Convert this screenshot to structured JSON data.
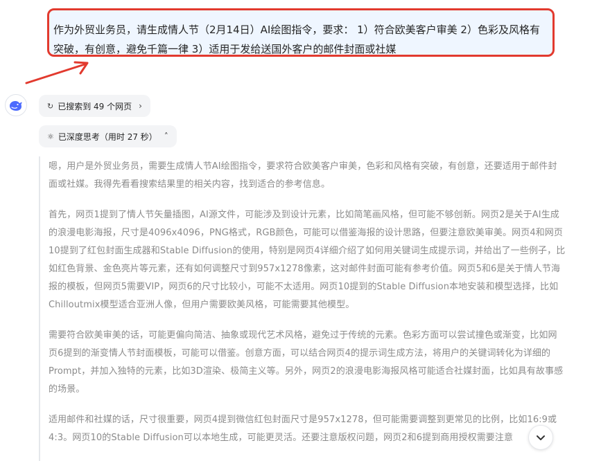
{
  "user_message": {
    "text": "作为外贸业务员，请生成情人节（2月14日）AI绘图指令，要求： 1）符合欧美客户审美  2）色彩及风格有突破，有创意，避免千篇一律  3）适用于发给送国外客户的邮件封面或社媒"
  },
  "annotation": {
    "border_color": "#e23a2e",
    "arrow_color": "#e23a2e"
  },
  "assistant": {
    "avatar_icon": "whale-logo-icon",
    "search_status": {
      "icon": "refresh-search-icon",
      "label": "已搜索到 49 个网页",
      "chevron": "chevron-right-icon"
    },
    "thinking_status": {
      "icon": "deep-think-icon",
      "label": "已深度思考（用时 27 秒）",
      "chevron": "chevron-up-icon"
    },
    "thinking_paragraphs": [
      "嗯，用户是外贸业务员，需要生成情人节AI绘图指令，要求符合欧美客户审美，色彩和风格有突破，有创意，还要适用于邮件封面或社媒。我得先看看搜索结果里的相关内容，找到适合的参考信息。",
      "首先，网页1提到了情人节矢量插图，AI源文件，可能涉及到设计元素，比如简笔画风格，但可能不够创新。网页2是关于AI生成的浪漫电影海报，尺寸是4096x4096，PNG格式，RGB颜色，可能可以借鉴海报的设计思路，但要注意欧美审美。网页4和网页10提到了红包封面生成器和Stable Diffusion的使用，特别是网页4详细介绍了如何用关键词生成提示词，并给出了一些例子，比如红色背景、金色亮片等元素，还有如何调整尺寸到957x1278像素，这对邮件封面可能有参考价值。网页5和6是关于情人节海报的模板，但网页5需要VIP，网页6的尺寸比较小，可能不太适用。网页10提到的Stable Diffusion本地安装和模型选择，比如Chilloutmix模型适合亚洲人像，但用户需要欧美风格，可能需要其他模型。",
      "需要符合欧美审美的话，可能更偏向简洁、抽象或现代艺术风格，避免过于传统的元素。色彩方面可以尝试撞色或渐变，比如网页6提到的渐变情人节封面模板，可能可以借鉴。创意方面，可以结合网页4的提示词生成方法，将用户的关键词转化为详细的Prompt，并加入独特的元素，比如3D渲染、极简主义等。另外，网页2的浪漫电影海报风格可能适合社媒封面，比如具有故事感的场景。",
      "适用邮件和社媒的话，尺寸很重要，网页4提到微信红包封面尺寸是957x1278，但可能需要调整到更常见的比例，比如16:9或4:3。网页10的Stable Diffusion可以本地生成，可能更灵活。还要注意版权问题，网页2和6提到商用授权需要注意"
    ]
  },
  "scroll_button": {
    "icon": "chevron-down-icon"
  }
}
